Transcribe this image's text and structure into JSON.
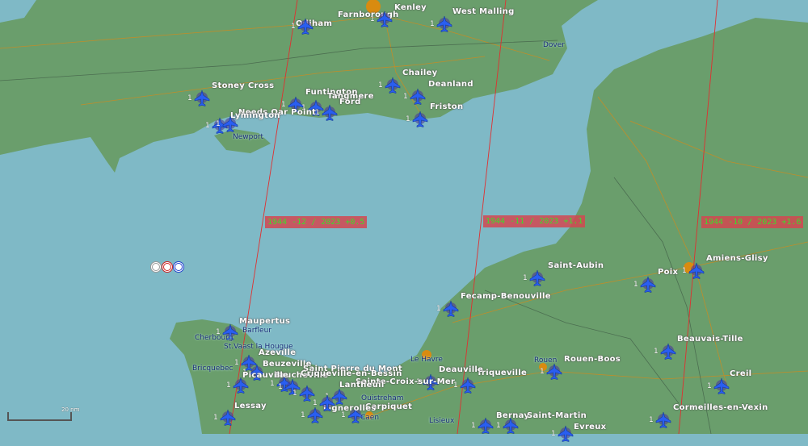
{
  "map": {
    "colors": {
      "water": "#7fb9c6",
      "land": "#6a9e6c",
      "road": "#d48a1a",
      "city": "#d98b10",
      "border": "#3f5a45",
      "mission_line": "#e03030"
    },
    "airfields": [
      {
        "name": "Farnborough",
        "count": "1"
      },
      {
        "name": "Odiham",
        "count": "1"
      },
      {
        "name": "Kenley",
        "count": "1"
      },
      {
        "name": "West Malling",
        "count": "1"
      },
      {
        "name": "Stoney Cross",
        "count": "1"
      },
      {
        "name": "Funtington",
        "count": "1"
      },
      {
        "name": "Tangmere",
        "count": "1"
      },
      {
        "name": "Ford",
        "count": "1"
      },
      {
        "name": "Needs Oar Point",
        "count": "1"
      },
      {
        "name": "Lymington",
        "count": "1"
      },
      {
        "name": "Chailey",
        "count": "1"
      },
      {
        "name": "Deanland",
        "count": "1"
      },
      {
        "name": "Friston",
        "count": "1"
      },
      {
        "name": "Saint-Aubin",
        "count": "1"
      },
      {
        "name": "Fecamp-Benouville",
        "count": "1"
      },
      {
        "name": "Poix",
        "count": "1"
      },
      {
        "name": "Amiens-Glisy",
        "count": "1"
      },
      {
        "name": "Beauvais-Tille",
        "count": "1"
      },
      {
        "name": "Rouen-Boos",
        "count": "1"
      },
      {
        "name": "Creil",
        "count": "1"
      },
      {
        "name": "Cormeilles-en-Vexin",
        "count": "1"
      },
      {
        "name": "Triqueville",
        "count": "1"
      },
      {
        "name": "Deauville",
        "count": "1"
      },
      {
        "name": "Bernay",
        "count": "1"
      },
      {
        "name": "Saint-Martin",
        "count": "1"
      },
      {
        "name": "Evreux",
        "count": "1"
      },
      {
        "name": "Maupertus",
        "count": "1"
      },
      {
        "name": "Azeville",
        "count": "1"
      },
      {
        "name": "Beuzeville",
        "count": "1"
      },
      {
        "name": "Brucheville",
        "count": "1"
      },
      {
        "name": "Saint Pierre du Mont",
        "count": "1"
      },
      {
        "name": "Criqueville-en-Bessin",
        "count": "1"
      },
      {
        "name": "Sainte-Croix-sur-Mer",
        "count": "1"
      },
      {
        "name": "Carpiquet",
        "count": "1"
      },
      {
        "name": "Lignerolles",
        "count": "1"
      },
      {
        "name": "Lessay",
        "count": "1"
      },
      {
        "name": "Picauville",
        "count": "1"
      },
      {
        "name": "Lantheuil",
        "count": "1"
      }
    ],
    "towns": [
      "Dover",
      "Newport",
      "Barfleur",
      "Cherbourg",
      "St.Vaast la Hougue",
      "Bricquebec",
      "Le Havre",
      "Rouen",
      "Lisieux",
      "Caen",
      "Ouistreham"
    ],
    "missions": [
      "1944 -12 / 2023 +0.5",
      "1944 -11 / 2023 +1.1",
      "1944 -10 / 2023 +1.6"
    ],
    "scale_label": "20 nm"
  }
}
